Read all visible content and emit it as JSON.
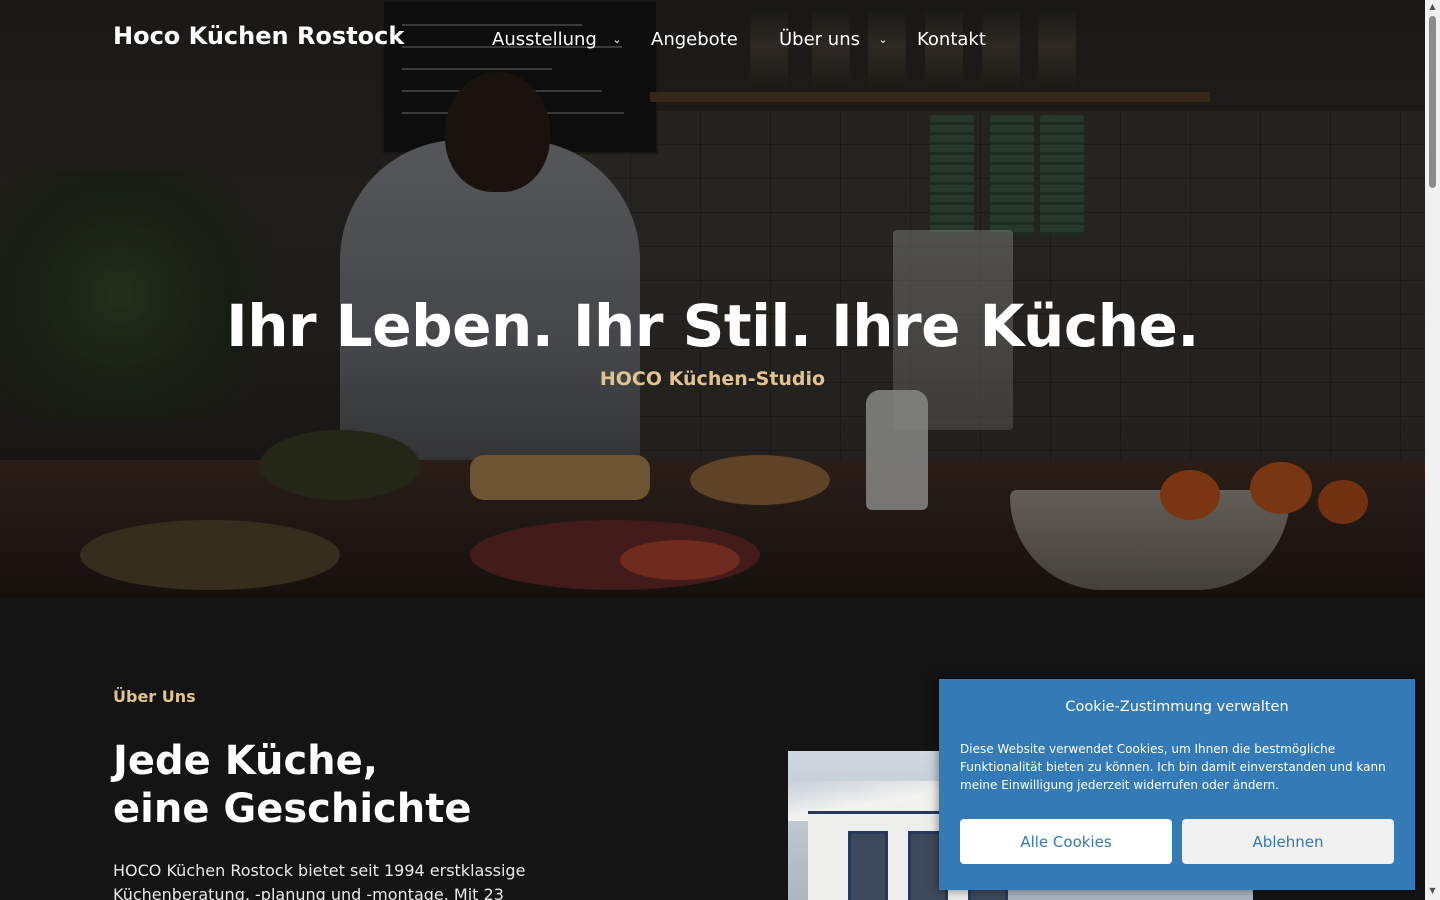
{
  "site": {
    "brand": "Hoco Küchen Rostock"
  },
  "nav": {
    "items": [
      {
        "label": "Ausstellung",
        "has_submenu": true
      },
      {
        "label": "Angebote",
        "has_submenu": false
      },
      {
        "label": "Über uns",
        "has_submenu": true
      },
      {
        "label": "Kontakt",
        "has_submenu": false
      }
    ],
    "chevron_icon": "chevron-down-icon"
  },
  "hero": {
    "title": "Ihr Leben. Ihr Stil. Ihre Küche.",
    "subtitle": "HOCO Küchen-Studio",
    "image": "cafe-counter-photo"
  },
  "about": {
    "eyebrow": "Über Uns",
    "title_line1": "Jede Küche,",
    "title_line2": "eine Geschichte",
    "text": "HOCO Küchen Rostock bietet seit 1994 erstklassige Küchenberatung, -planung und -montage. Mit 23",
    "image": "studio-building-photo"
  },
  "cookie": {
    "title": "Cookie-Zustimmung verwalten",
    "text": "Diese Website verwendet Cookies, um Ihnen die bestmögliche Funktionalität bieten zu können. Ich bin damit einverstanden und kann meine Einwilligung jederzeit widerrufen oder ändern.",
    "accept_label": "Alle Cookies",
    "deny_label": "Ablehnen"
  },
  "colors": {
    "accent_gold": "#e2c291",
    "cookie_blue": "#337ab7",
    "page_dark": "#141414"
  }
}
